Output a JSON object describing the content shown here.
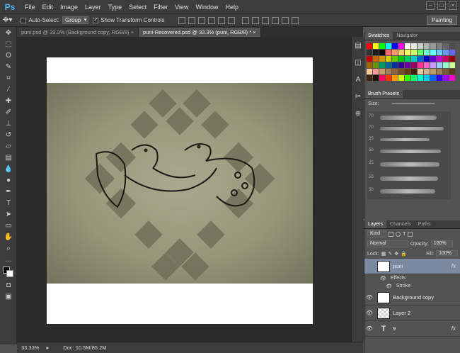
{
  "app": {
    "logo": "Ps"
  },
  "menu": [
    "File",
    "Edit",
    "Image",
    "Layer",
    "Type",
    "Select",
    "Filter",
    "View",
    "Window",
    "Help"
  ],
  "window_controls": [
    "–",
    "□",
    "×"
  ],
  "options": {
    "auto_select_label": "Auto-Select:",
    "auto_select_value": "Group",
    "show_transform_label": "Show Transform Controls",
    "workspace_button": "Painting"
  },
  "tabs": [
    {
      "label": "puni.psd @ 33.3% (Background copy, RGB/8)",
      "active": false,
      "close": "×"
    },
    {
      "label": "puni-Recovered.psd @ 33.3% (puni, RGB/8) *",
      "active": true,
      "close": "×"
    }
  ],
  "status": {
    "zoom": "33.33%",
    "doc": "Doc: 10.5M/85.2M"
  },
  "panels": {
    "swatches_tab": "Swatches",
    "navigator_tab": "Navigator",
    "brush_presets_tab": "Brush Presets",
    "brush_size_label": "Size:",
    "brush_sizes": [
      "70",
      "70",
      "25",
      "50",
      "25",
      "50",
      "50"
    ],
    "layers_tab": "Layers",
    "channels_tab": "Channels",
    "paths_tab": "Paths",
    "kind_value": "Kind",
    "blend_mode": "Normal",
    "opacity_label": "Opacity:",
    "opacity_value": "100%",
    "lock_label": "Lock:",
    "fill_label": "Fill:",
    "fill_value": "100%"
  },
  "layers": [
    {
      "name": "puni",
      "selected": true,
      "fx": "fx"
    },
    {
      "name": "Layer 2",
      "selected": false,
      "fx": ""
    },
    {
      "name": "Background copy",
      "selected": false,
      "fx": ""
    },
    {
      "name": "9",
      "selected": false,
      "fx": "fx"
    }
  ],
  "layer_effects": {
    "effects": "Effects",
    "stroke": "Stroke"
  },
  "swatch_colors": [
    "#ff0000",
    "#ffff00",
    "#00ff00",
    "#00ffff",
    "#0000ff",
    "#ff00ff",
    "#ffffff",
    "#e6e6e6",
    "#cccccc",
    "#b3b3b3",
    "#999999",
    "#808080",
    "#666666",
    "#4d4d4d",
    "#333333",
    "#1a1a1a",
    "#000000",
    "#ff6666",
    "#ff9966",
    "#ffcc66",
    "#ffff66",
    "#ccff66",
    "#66ff66",
    "#66ffcc",
    "#66ffff",
    "#66ccff",
    "#6699ff",
    "#6666ff",
    "#cc0000",
    "#cc6600",
    "#cc9900",
    "#cccc00",
    "#66cc00",
    "#00cc00",
    "#00cc66",
    "#00cccc",
    "#0066cc",
    "#0000cc",
    "#6600cc",
    "#cc00cc",
    "#cc0066",
    "#990000",
    "#996600",
    "#669900",
    "#009966",
    "#006699",
    "#003399",
    "#330099",
    "#660099",
    "#990066",
    "#ff3399",
    "#ff66cc",
    "#cc99ff",
    "#99ccff",
    "#99ffcc",
    "#ccff99",
    "#ffcc99",
    "#ff9999",
    "#c69c6d",
    "#a67c52",
    "#8c6239",
    "#754c24",
    "#603913",
    "#42210b",
    "#e6c8a0",
    "#d2b48c",
    "#bc9a6a",
    "#9e7b4f",
    "#7c5a32",
    "#5a3c1e",
    "#3d2410",
    "#1f1208",
    "#ff0066",
    "#ff3300",
    "#ff9900",
    "#ccff00",
    "#33ff00",
    "#00ff66",
    "#00ffcc",
    "#00ccff",
    "#0066ff",
    "#3300ff",
    "#9900ff",
    "#ff00cc"
  ]
}
